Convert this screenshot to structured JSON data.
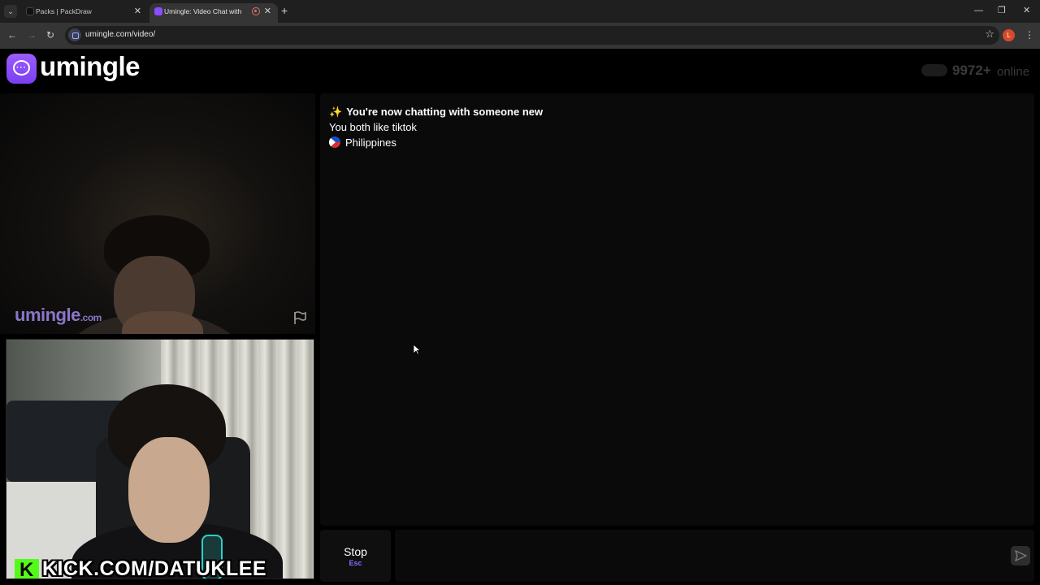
{
  "browser": {
    "tabs": [
      {
        "title": "Packs | PackDraw",
        "active": false
      },
      {
        "title": "Umingle: Video Chat with S",
        "active": true
      }
    ],
    "new_tab_label": "+",
    "url": "umingle.com/video/",
    "profile_initial": "L",
    "window_controls": {
      "minimize": "—",
      "restore": "❐",
      "close": "✕"
    }
  },
  "header": {
    "logo_text": "umingle",
    "online_count": "9972+",
    "online_label": "online"
  },
  "stranger_video": {
    "watermark": "umingle",
    "watermark_suffix": ".com"
  },
  "self_video": {
    "overlay_text": "KICK.COM/DATUKLEE",
    "overlay_logo_letter": "K"
  },
  "chat": {
    "messages": [
      {
        "icon": "✨",
        "text": "You're now chatting with someone new",
        "bold": true
      },
      {
        "text": "You both like tiktok"
      },
      {
        "flag": "Philippines",
        "text": "Philippines"
      }
    ]
  },
  "controls": {
    "stop_label": "Stop",
    "stop_hotkey": "Esc",
    "message_placeholder": ""
  },
  "colors": {
    "accent": "#8f6bff",
    "kick_green": "#53fc18",
    "background": "#000000"
  }
}
